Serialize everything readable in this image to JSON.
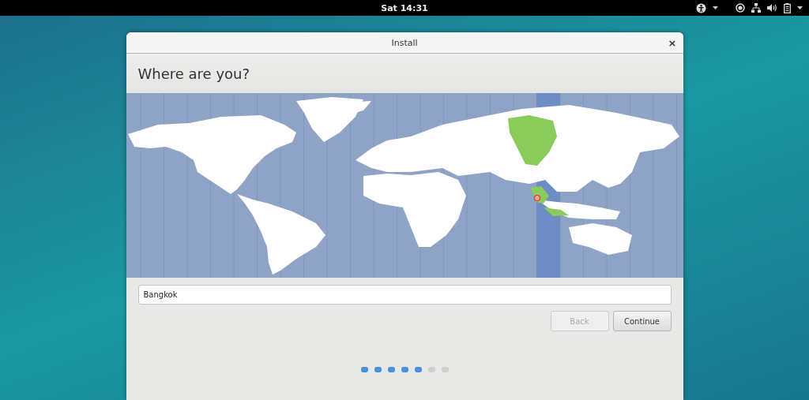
{
  "top_bar": {
    "clock": "Sat 14:31"
  },
  "window": {
    "title": "Install",
    "close": "×"
  },
  "page": {
    "heading": "Where are you?"
  },
  "location_field": {
    "value": "Bangkok"
  },
  "buttons": [
    {
      "label": "Back",
      "disabled": true
    },
    {
      "label": "Continue",
      "disabled": false
    }
  ],
  "steps": [
    {
      "done": true
    },
    {
      "done": true
    },
    {
      "done": true
    },
    {
      "done": true
    },
    {
      "done": true
    },
    {
      "done": false
    },
    {
      "done": false
    }
  ]
}
